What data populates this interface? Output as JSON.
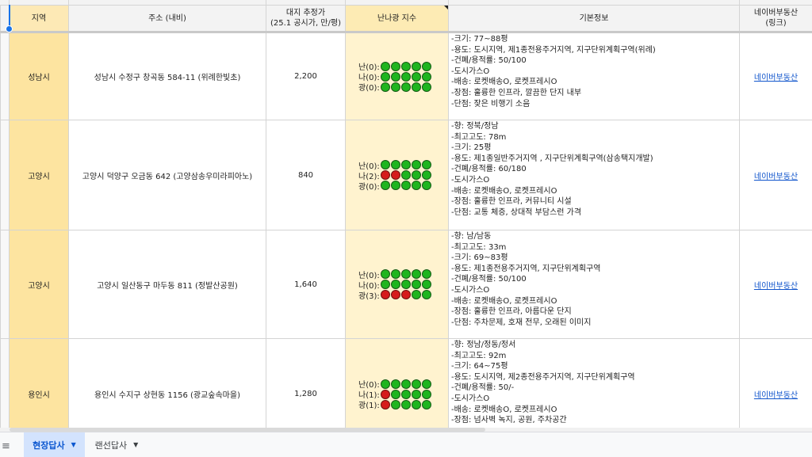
{
  "headers": {
    "region": "지역",
    "address": "주소 (내비)",
    "price_line1": "대지 추정가",
    "price_line2": "(25.1 공시가, 만/평)",
    "nanna": "난나광 지수",
    "info": "기본정보",
    "link_line1": "네이버부동산",
    "link_line2": "(링크)"
  },
  "rows": [
    {
      "region": "성남시",
      "address": "성남시 수정구 창곡동 584-11 (위례한빛초)",
      "price": "2,200",
      "nanna": [
        {
          "label": "난(0):",
          "dots": [
            "green",
            "green",
            "green",
            "green",
            "green"
          ]
        },
        {
          "label": "나(0):",
          "dots": [
            "green",
            "green",
            "green",
            "green",
            "green"
          ]
        },
        {
          "label": "광(0):",
          "dots": [
            "green",
            "green",
            "green",
            "green",
            "green"
          ]
        }
      ],
      "info": [
        "-크기: 77~88평",
        "-용도: 도시지역, 제1종전용주거지역, 지구단위계획구역(위례)",
        "-건폐/용적률: 50/100",
        "-도시가스O",
        "-배송: 로켓배송O, 로켓프레시O",
        "-장점: 훌륭한 인프라, 깔끔한 단지 내부",
        "-단점: 잦은 비행기 소음"
      ],
      "link": "네이버부동산"
    },
    {
      "region": "고양시",
      "address": "고양시 덕양구 오금동 642 (고양삼송우미라피아노)",
      "price": "840",
      "nanna": [
        {
          "label": "난(0):",
          "dots": [
            "green",
            "green",
            "green",
            "green",
            "green"
          ]
        },
        {
          "label": "나(2):",
          "dots": [
            "red",
            "red",
            "green",
            "green",
            "green"
          ]
        },
        {
          "label": "광(0):",
          "dots": [
            "green",
            "green",
            "green",
            "green",
            "green"
          ]
        }
      ],
      "info": [
        "-향: 정북/정남",
        "-최고고도: 78m",
        "-크기: 25평",
        "-용도: 제1종일반주거지역 , 지구단위계획구역(삼송택지개발)",
        "-건폐/용적률: 60/180",
        "-도시가스O",
        "-배송: 로켓배송O, 로켓프레시O",
        "-장점: 훌륭한 인프라, 커뮤니티 시설",
        "-단점: 교통 체증, 상대적 부담스런 가격"
      ],
      "link": "네이버부동산"
    },
    {
      "region": "고양시",
      "address": "고양시 일산동구 마두동 811 (정발산공원)",
      "price": "1,640",
      "nanna": [
        {
          "label": "난(0):",
          "dots": [
            "green",
            "green",
            "green",
            "green",
            "green"
          ]
        },
        {
          "label": "나(0):",
          "dots": [
            "green",
            "green",
            "green",
            "green",
            "green"
          ]
        },
        {
          "label": "광(3):",
          "dots": [
            "red",
            "red",
            "red",
            "green",
            "green"
          ]
        }
      ],
      "info": [
        "-향: 남/남동",
        "-최고고도: 33m",
        "-크기: 69~83평",
        "-용도: 제1종전용주거지역, 지구단위계획구역",
        "-건폐/용적률: 50/100",
        "-도시가스O",
        "-배송: 로켓배송O, 로켓프레시O",
        "-장점: 훌륭한 인프라, 아름다운 단지",
        "-단점: 주차문제, 호재 전무, 오래된 이미지"
      ],
      "link": "네이버부동산"
    },
    {
      "region": "용인시",
      "address": "용인시 수지구 상현동 1156 (광교숲속마을)",
      "price": "1,280",
      "nanna": [
        {
          "label": "난(0):",
          "dots": [
            "green",
            "green",
            "green",
            "green",
            "green"
          ]
        },
        {
          "label": "나(1):",
          "dots": [
            "red",
            "green",
            "green",
            "green",
            "green"
          ]
        },
        {
          "label": "광(1):",
          "dots": [
            "red",
            "green",
            "green",
            "green",
            "green"
          ]
        }
      ],
      "info": [
        "-향: 정남/정동/정서",
        "-최고고도: 92m",
        "-크기: 64~75평",
        "-용도: 도시지역, 제2종전용주거지역, 지구단위계획구역",
        "-건폐/용적률: 50/-",
        "-도시가스O",
        "-배송: 로켓배송O, 로켓프레시O",
        "-장점: 넘사벽 녹지, 공원, 주차공간"
      ],
      "link": "네이버부동산"
    }
  ],
  "tabs": [
    {
      "label": "현장답사",
      "active": true
    },
    {
      "label": "랜선답사",
      "active": false
    }
  ],
  "colors": {
    "green_dot": "#1fb51f",
    "red_dot": "#d61c1c",
    "region_fill": "#fde4a0",
    "nanna_fill": "#fff3cf",
    "link": "#1155cc",
    "active_tab": "#d3e3fd"
  }
}
